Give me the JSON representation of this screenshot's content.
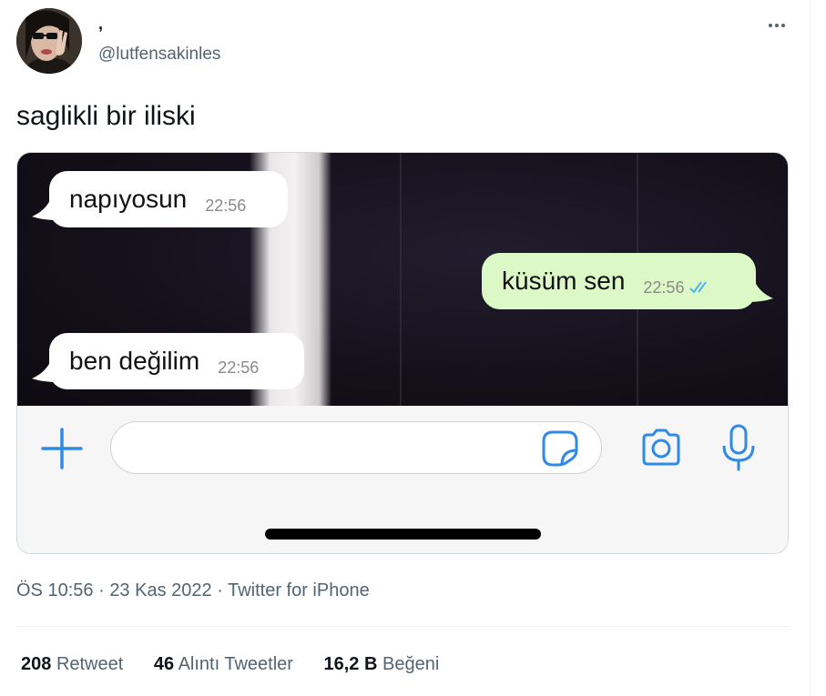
{
  "tweet": {
    "display_name": ",",
    "handle": "@lutfensakinles",
    "text": "saglikli bir iliski",
    "more_icon": "more-horizontal-icon",
    "time": "ÖS 10:56",
    "separator": "·",
    "date": "23 Kas 2022",
    "source": "Twitter for iPhone"
  },
  "chat": {
    "messages": [
      {
        "direction": "incoming",
        "text": "napıyosun",
        "time": "22:56"
      },
      {
        "direction": "outgoing",
        "text": "küsüm sen",
        "time": "22:56",
        "status": "read"
      },
      {
        "direction": "incoming",
        "text": "ben değilim",
        "time": "22:56"
      }
    ],
    "colors": {
      "incoming_bubble": "#ffffff",
      "outgoing_bubble": "#dcf8c6",
      "accent": "#2f8ae6",
      "read_ticks": "#4fb6ec"
    },
    "icons": [
      "plus-icon",
      "sticker-icon",
      "camera-icon",
      "microphone-icon"
    ]
  },
  "stats": {
    "retweets_count": "208",
    "retweets_label": "Retweet",
    "quotes_count": "46",
    "quotes_label": "Alıntı Tweetler",
    "likes_count": "16,2 B",
    "likes_label": "Beğeni"
  }
}
